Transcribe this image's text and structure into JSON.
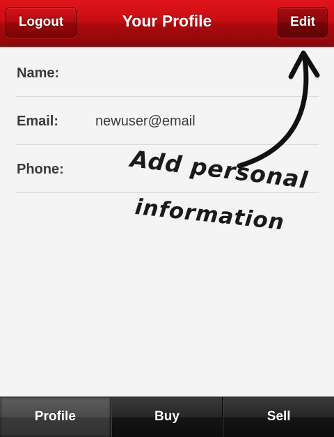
{
  "header": {
    "title": "Your Profile",
    "logout_label": "Logout",
    "edit_label": "Edit",
    "color": "#c40d12"
  },
  "profile": {
    "fields": [
      {
        "label": "Name:",
        "value": ""
      },
      {
        "label": "Email:",
        "value": "newuser@email"
      },
      {
        "label": "Phone:",
        "value": ""
      }
    ]
  },
  "annotation": {
    "line1": "Add personal",
    "line2": "information",
    "icon": "curved-arrow-icon"
  },
  "tabbar": {
    "active_tab": "Profile",
    "tabs": [
      {
        "label": "Profile"
      },
      {
        "label": "Buy"
      },
      {
        "label": "Sell"
      }
    ]
  }
}
